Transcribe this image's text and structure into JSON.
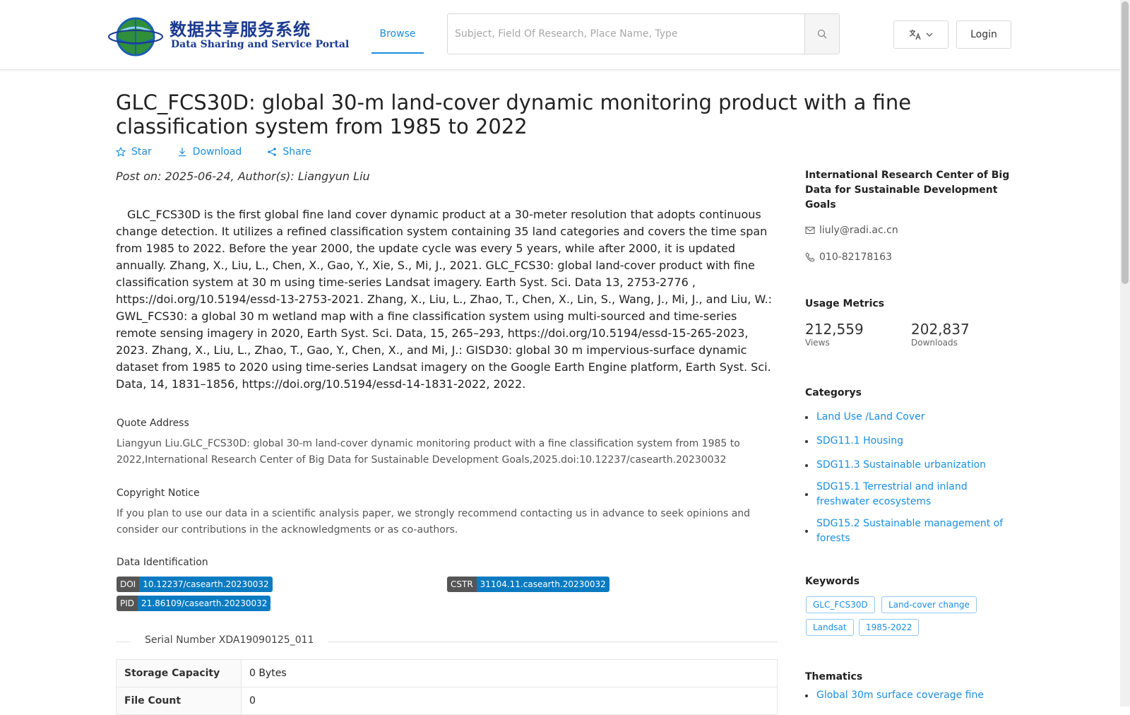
{
  "header": {
    "logo_cn": "数据共享服务系统",
    "logo_en": "Data Sharing and Service Portal",
    "nav_browse": "Browse",
    "search_placeholder": "Subject, Field Of Research, Place Name, Type",
    "login": "Login"
  },
  "article": {
    "title": "GLC_FCS30D: global 30-m land-cover dynamic monitoring product with a fine classification system from 1985 to 2022",
    "actions": {
      "star": "Star",
      "download": "Download",
      "share": "Share"
    },
    "post_on": "Post on: 2025-06-24, Author(s): Liangyun Liu",
    "description": "GLC_FCS30D is the first global fine land cover dynamic product at a 30-meter resolution that adopts continuous change detection. It utilizes a refined classification system containing 35 land categories and covers the time span from 1985 to 2022. Before the year 2000, the update cycle was every 5 years, while after 2000, it is updated annually. Zhang, X., Liu, L., Chen, X., Gao, Y., Xie, S., Mi, J., 2021. GLC_FCS30: global land-cover product with fine classification system at 30 m using time-series Landsat imagery. Earth Syst. Sci. Data 13, 2753-2776 , https://doi.org/10.5194/essd-13-2753-2021. Zhang, X., Liu, L., Zhao, T., Chen, X., Lin, S., Wang, J., Mi, J., and Liu, W.: GWL_FCS30: a global 30 m wetland map with a fine classification system using multi-sourced and time-series remote sensing imagery in 2020, Earth Syst. Sci. Data, 15, 265–293, https://doi.org/10.5194/essd-15-265-2023, 2023. Zhang, X., Liu, L., Zhao, T., Gao, Y., Chen, X., and Mi, J.: GISD30: global 30 m impervious-surface dynamic dataset from 1985 to 2020 using time-series Landsat imagery on the Google Earth Engine platform, Earth Syst. Sci. Data, 14, 1831–1856, https://doi.org/10.5194/essd-14-1831-2022, 2022.",
    "quote_label": "Quote Address",
    "quote_text": "Liangyun Liu.GLC_FCS30D: global 30-m land-cover dynamic monitoring product with a fine classification system from 1985 to 2022,International Research Center of Big Data for Sustainable Development Goals,2025.doi:10.12237/casearth.20230032",
    "copyright_label": "Copyright Notice",
    "copyright_text": "If you plan to use our data in a scientific analysis paper, we strongly recommend contacting us in advance to seek opinions and consider our contributions in the acknowledgments or as co-authors.",
    "data_id_label": "Data Identification",
    "ids": {
      "doi_key": "DOI",
      "doi_val": "10.12237/casearth.20230032",
      "cstr_key": "CSTR",
      "cstr_val": "31104.11.casearth.20230032",
      "pid_key": "PID",
      "pid_val": "21.86109/casearth.20230032"
    },
    "serial": "Serial Number XDA19090125_011",
    "table": [
      {
        "key": "Storage Capacity",
        "value": "0 Bytes"
      },
      {
        "key": "File Count",
        "value": "0"
      }
    ]
  },
  "sidebar": {
    "org": "International Research Center of Big Data for Sustainable Development Goals",
    "email": "liuly@radi.ac.cn",
    "phone": "010-82178163",
    "usage_title": "Usage Metrics",
    "views": "212,559",
    "views_label": "Views",
    "downloads": "202,837",
    "downloads_label": "Downloads",
    "categories_title": "Categorys",
    "categories": [
      "Land Use /Land Cover",
      "SDG11.1 Housing",
      "SDG11.3 Sustainable urbanization",
      "SDG15.1 Terrestrial and inland freshwater ecosystems",
      "SDG15.2 Sustainable management of forests"
    ],
    "keywords_title": "Keywords",
    "keywords": [
      "GLC_FCS30D",
      "Land-cover change",
      "Landsat",
      "1985-2022"
    ],
    "thematics_title": "Thematics",
    "thematics": [
      "Global 30m surface coverage fine"
    ]
  },
  "colors": {
    "accent": "#1a8ee0",
    "badge_value": "#0a7bc1",
    "badge_key": "#555555"
  },
  "icons": {
    "star": "star-icon",
    "download": "download-icon",
    "share": "share-icon",
    "search": "search-icon",
    "language": "translate-icon",
    "email": "mail-icon",
    "phone": "phone-icon"
  }
}
